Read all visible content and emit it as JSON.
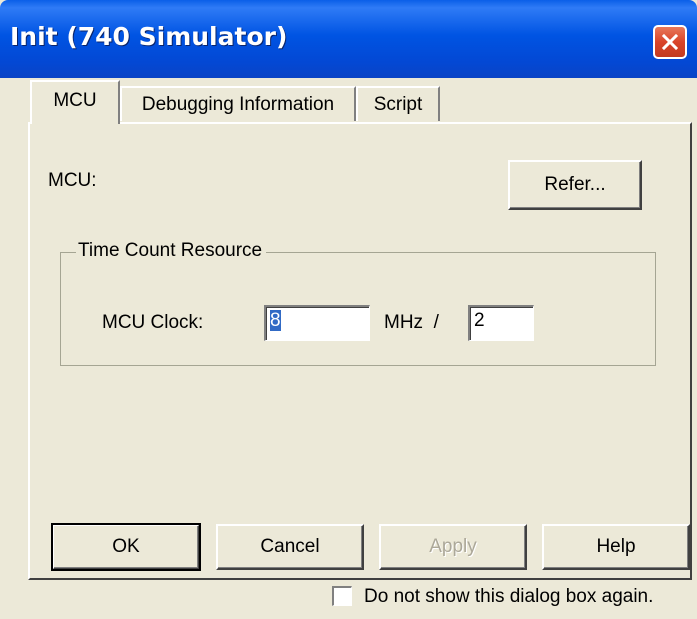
{
  "window": {
    "title": "Init (740 Simulator)"
  },
  "tabs": [
    {
      "label": "MCU",
      "active": true
    },
    {
      "label": "Debugging Information",
      "active": false
    },
    {
      "label": "Script",
      "active": false
    }
  ],
  "mcu_tab": {
    "mcu_label": "MCU:",
    "refer_button": "Refer...",
    "time_count_group": {
      "title": "Time Count Resource",
      "mcu_clock_label": "MCU Clock:",
      "clock_value": "8",
      "unit_label": "MHz  /",
      "divider_value": "2"
    }
  },
  "buttons": {
    "ok": "OK",
    "cancel": "Cancel",
    "apply": "Apply",
    "help": "Help"
  },
  "footer": {
    "checkbox_label": "Do not show this dialog box again.",
    "checkbox_checked": false
  },
  "colors": {
    "titlebar": "#0054e3",
    "dialog_bg": "#ece9d8",
    "selection": "#316ac5",
    "close_button": "#d9442a"
  },
  "icons": {
    "close": "close-x-icon"
  }
}
